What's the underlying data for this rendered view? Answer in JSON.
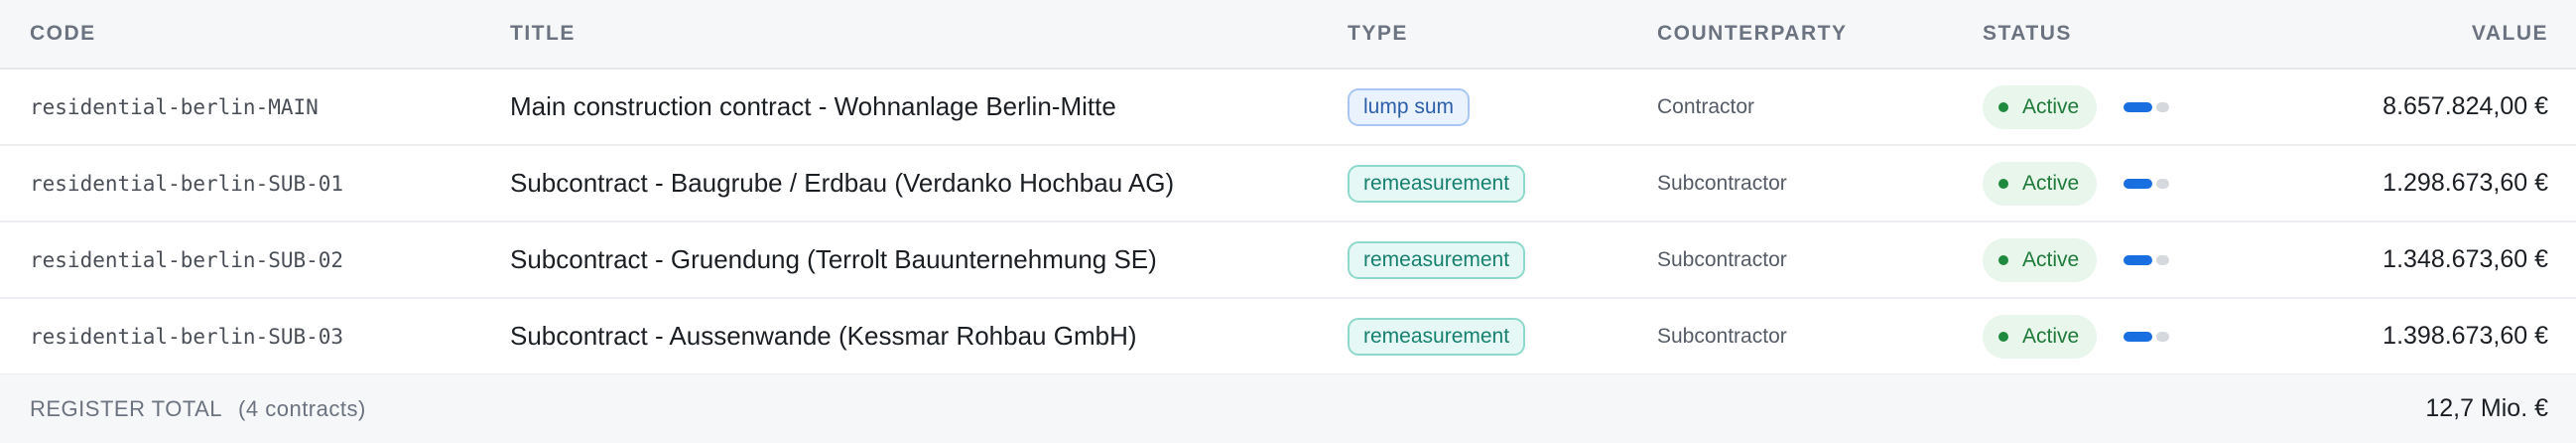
{
  "columns": {
    "code": "CODE",
    "title": "TITLE",
    "type": "TYPE",
    "counterparty": "COUNTERPARTY",
    "status": "STATUS",
    "value": "VALUE"
  },
  "rows": [
    {
      "code": "residential-berlin-MAIN",
      "title": "Main construction contract - Wohnanlage Berlin-Mitte",
      "type": "lump sum",
      "counterparty": "Contractor",
      "status": "Active",
      "progress_fraction": 0.7,
      "value": "8.657.824,00 €"
    },
    {
      "code": "residential-berlin-SUB-01",
      "title": "Subcontract - Baugrube / Erdbau (Verdanko Hochbau AG)",
      "type": "remeasurement",
      "counterparty": "Subcontractor",
      "status": "Active",
      "progress_fraction": 0.7,
      "value": "1.298.673,60 €"
    },
    {
      "code": "residential-berlin-SUB-02",
      "title": "Subcontract - Gruendung (Terrolt Bauunternehmung SE)",
      "type": "remeasurement",
      "counterparty": "Subcontractor",
      "status": "Active",
      "progress_fraction": 0.7,
      "value": "1.348.673,60 €"
    },
    {
      "code": "residential-berlin-SUB-03",
      "title": "Subcontract - Aussenwande (Kessmar Rohbau GmbH)",
      "type": "remeasurement",
      "counterparty": "Subcontractor",
      "status": "Active",
      "progress_fraction": 0.7,
      "value": "1.398.673,60 €"
    }
  ],
  "footer": {
    "label": "REGISTER TOTAL",
    "count": "(4 contracts)",
    "total": "12,7 Mio. €"
  },
  "colors": {
    "header_bg": "#f6f7f8",
    "chip_lump_bg": "#eaf2fd",
    "chip_remeasurement_bg": "#e6f8f5",
    "status_active_bg": "#e8f6ec",
    "progress_accent": "#1a6fe0"
  }
}
